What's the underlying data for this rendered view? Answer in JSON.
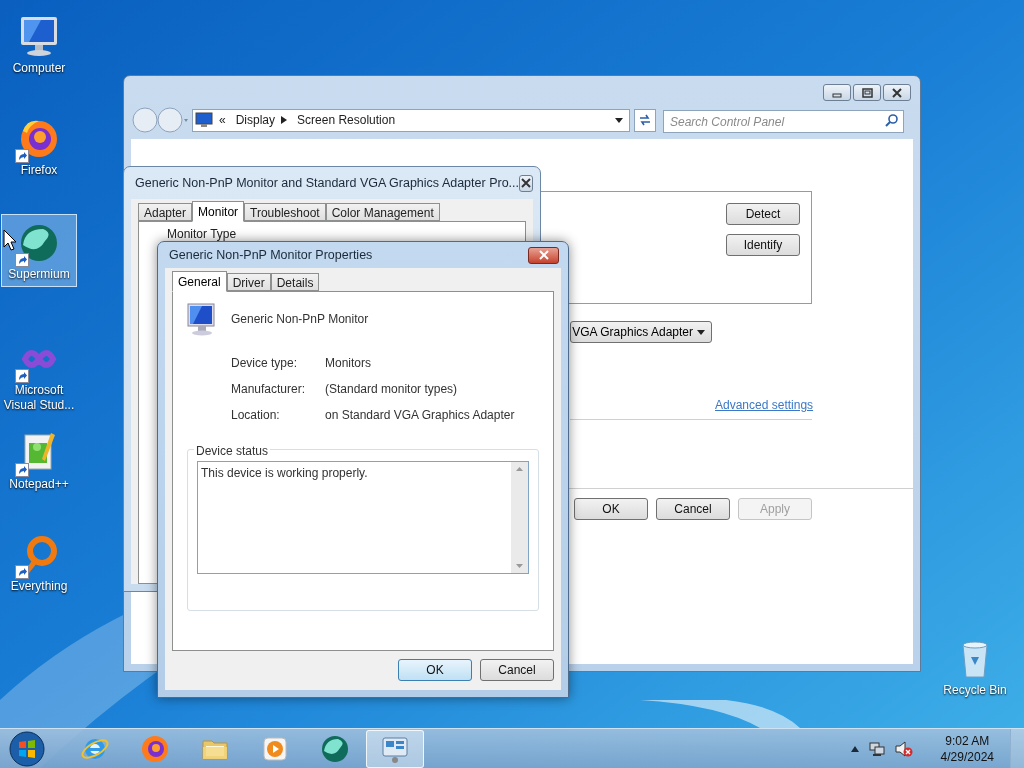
{
  "desktop_icons": [
    {
      "kind": "computer",
      "label": "Computer",
      "shortcut": false,
      "selected": false
    },
    {
      "kind": "firefox",
      "label": "Firefox",
      "shortcut": true,
      "selected": false
    },
    {
      "kind": "supermium",
      "label": "Supermium",
      "shortcut": true,
      "selected": true
    },
    {
      "kind": "visualstudio",
      "label": "Microsoft Visual Stud...",
      "shortcut": true,
      "selected": false
    },
    {
      "kind": "notepad",
      "label": "Notepad++",
      "shortcut": true,
      "selected": false
    },
    {
      "kind": "everything",
      "label": "Everything",
      "shortcut": true,
      "selected": false
    },
    {
      "kind": "recycle",
      "label": "Recycle Bin",
      "shortcut": false,
      "selected": false
    }
  ],
  "control_panel": {
    "overflow_chevron": "«",
    "breadcrumb": [
      "Display",
      "Screen Resolution"
    ],
    "search": {
      "placeholder": "Search Control Panel"
    },
    "monitor_buttons": [
      "Detect",
      "Identify"
    ],
    "adapter_dropdown": "VGA Graphics Adapter",
    "link": "Advanced settings",
    "footer_buttons": [
      {
        "label": "OK",
        "disabled": false
      },
      {
        "label": "Cancel",
        "disabled": false
      },
      {
        "label": "Apply",
        "disabled": true
      }
    ]
  },
  "adapter_dialog": {
    "title": "Generic Non-PnP Monitor and Standard VGA Graphics Adapter Pro...",
    "tabs": [
      {
        "label": "Adapter",
        "selected": false
      },
      {
        "label": "Monitor",
        "selected": true
      },
      {
        "label": "Troubleshoot",
        "selected": false
      },
      {
        "label": "Color Management",
        "selected": false
      }
    ],
    "group_label": "Monitor Type"
  },
  "properties_dialog": {
    "title": "Generic Non-PnP Monitor Properties",
    "tabs": [
      {
        "label": "General",
        "selected": true
      },
      {
        "label": "Driver",
        "selected": false
      },
      {
        "label": "Details",
        "selected": false
      }
    ],
    "device_name": "Generic Non-PnP Monitor",
    "properties": [
      {
        "label": "Device type:",
        "value": "Monitors"
      },
      {
        "label": "Manufacturer:",
        "value": "(Standard monitor types)"
      },
      {
        "label": "Location:",
        "value": "on Standard VGA Graphics Adapter"
      }
    ],
    "status_group": "Device status",
    "status_text": "This device is working properly.",
    "buttons": [
      {
        "label": "OK",
        "default": true
      },
      {
        "label": "Cancel",
        "default": false
      }
    ]
  },
  "taskbar": {
    "apps": [
      {
        "kind": "ie",
        "active": false
      },
      {
        "kind": "firefox",
        "active": false
      },
      {
        "kind": "folder",
        "active": false
      },
      {
        "kind": "media",
        "active": false
      },
      {
        "kind": "supermium",
        "active": false
      },
      {
        "kind": "controlpanel",
        "active": true
      }
    ],
    "volume_muted": true,
    "time": "9:02 AM",
    "date": "4/29/2024"
  }
}
